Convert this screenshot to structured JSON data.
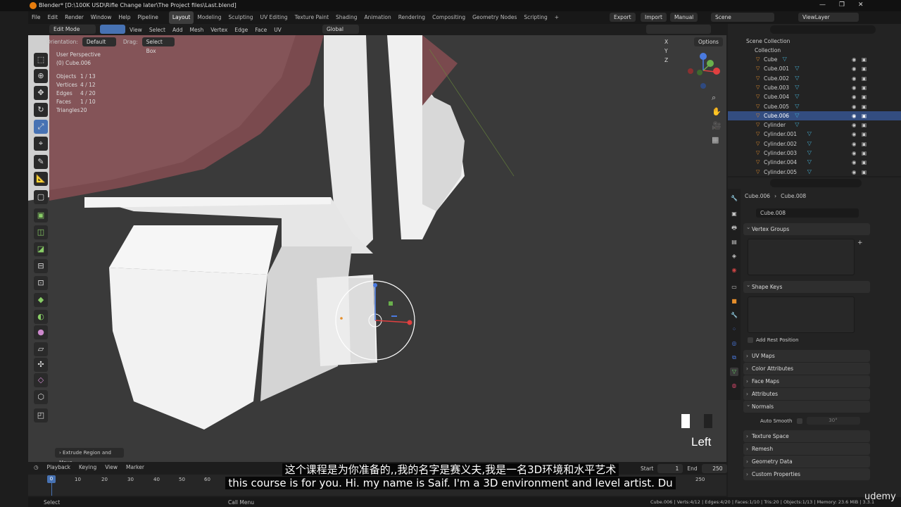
{
  "title": "Blender* [D:\\100K USD\\Rifle Change later\\The Project files\\Last.blend]",
  "menu": [
    "File",
    "Edit",
    "Render",
    "Window",
    "Help",
    "Pipeline"
  ],
  "workspaces": [
    "Layout",
    "Modeling",
    "Sculpting",
    "UV Editing",
    "Texture Paint",
    "Shading",
    "Animation",
    "Rendering",
    "Compositing",
    "Geometry Nodes",
    "Scripting"
  ],
  "active_workspace": "Layout",
  "topright": {
    "export": "Export",
    "import": "Import",
    "manual": "Manual",
    "scene": "Scene",
    "viewlayer": "ViewLayer"
  },
  "header": {
    "mode": "Edit Mode",
    "menus": [
      "View",
      "Select",
      "Add",
      "Mesh",
      "Vertex",
      "Edge",
      "Face",
      "UV"
    ],
    "transform": "Global"
  },
  "header2": {
    "orientation_label": "Orientation:",
    "orientation": "Default",
    "drag_label": "Drag:",
    "drag": "Select Box",
    "options": "Options",
    "axes": "X Y Z"
  },
  "viewport_info": {
    "view": "User Perspective",
    "object": "(0) Cube.006"
  },
  "stats": [
    {
      "label": "Objects",
      "value": "1 / 13"
    },
    {
      "label": "Vertices",
      "value": "4 / 12"
    },
    {
      "label": "Edges",
      "value": "4 / 20"
    },
    {
      "label": "Faces",
      "value": "1 / 10"
    },
    {
      "label": "Triangles",
      "value": "20"
    }
  ],
  "operator_panel": "Extrude Region and Move",
  "view_label": "Left",
  "outliner": {
    "scene_collection": "Scene Collection",
    "collection": "Collection",
    "items": [
      "Cube",
      "Cube.001",
      "Cube.002",
      "Cube.003",
      "Cube.004",
      "Cube.005",
      "Cube.006",
      "Cylinder",
      "Cylinder.001",
      "Cylinder.002",
      "Cylinder.003",
      "Cylinder.004",
      "Cylinder.005"
    ],
    "selected": "Cube.006"
  },
  "properties": {
    "object": "Cube.006",
    "mesh": "Cube.008",
    "datablock": "Cube.008",
    "panels": [
      "Vertex Groups",
      "Shape Keys",
      "UV Maps",
      "Color Attributes",
      "Face Maps",
      "Attributes",
      "Normals",
      "Texture Space",
      "Remesh",
      "Geometry Data",
      "Custom Properties"
    ],
    "add_rest_position": "Add Rest Position",
    "auto_smooth": "Auto Smooth",
    "auto_smooth_angle": "30°"
  },
  "timeline": {
    "menus": [
      "Playback",
      "Keying",
      "View",
      "Marker"
    ],
    "start_label": "Start",
    "start": "1",
    "end_label": "End",
    "end": "250",
    "current_frame": "0",
    "ticks": [
      "0",
      "10",
      "20",
      "30",
      "40",
      "50",
      "60",
      "250"
    ]
  },
  "status": {
    "left": "Select",
    "middle": "Call Menu",
    "right": "Cube.006 | Verts:4/12 | Edges:4/20 | Faces:1/10 | Tris:20 | Objects:1/13 | Memory: 23.6 MiB | 3.3.1"
  },
  "subtitles": {
    "cn": "这个课程是为你准备的,,我的名字是赛义夫,我是一名3D环境和水平艺术",
    "en": "this course is for you. Hi. my name is Saif. I'm a 3D environment and level artist. Du"
  },
  "watermark": "udemy"
}
